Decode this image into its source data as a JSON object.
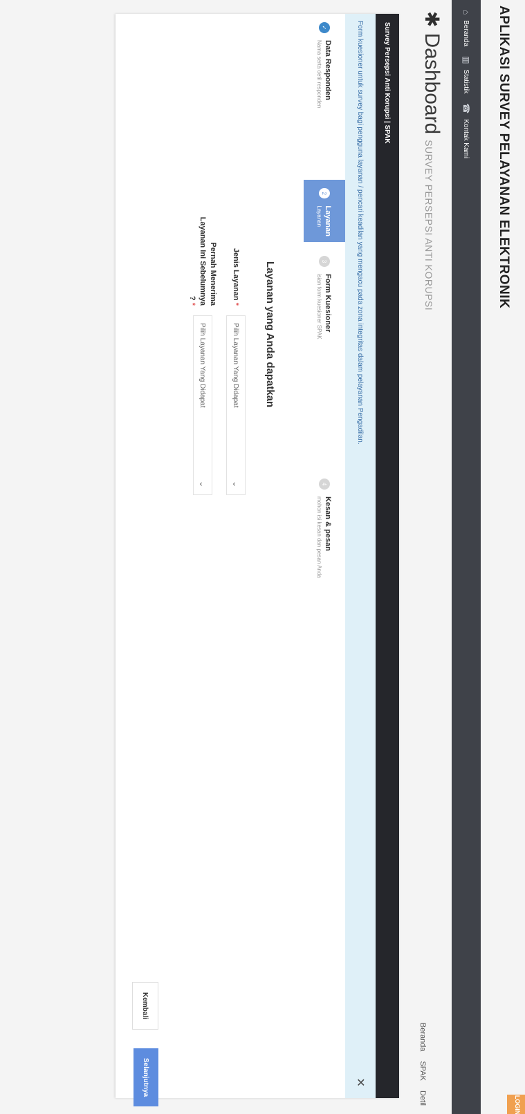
{
  "app_title": "APLIKASI SURVEY PELAYANAN ELEKTRONIK",
  "login_label": "LOGIN",
  "nav": [
    {
      "label": "Beranda",
      "icon": "home-icon"
    },
    {
      "label": "Statistik",
      "icon": "chart-icon"
    },
    {
      "label": "Kontak Kami",
      "icon": "phone-icon"
    }
  ],
  "dashboard": {
    "title": "Dashboard",
    "subtitle": "SURVEY PERSEPSI ANTI KORUPSI"
  },
  "top_links": [
    "Beranda",
    "SPAK",
    "Detil"
  ],
  "panel": {
    "header": "Survey Persepsi Anti Korupsi | SPAK",
    "info": "Form kuesioner untuk survey bagi pengguna layanan / pencari keadilan yang mengacu pada zona integritas dalam pelayanan Pengadilan."
  },
  "steps": [
    {
      "num": "✓",
      "title": "Data Responden",
      "subtitle": "Nama serta detil responden",
      "state": "done"
    },
    {
      "num": "2",
      "title": "Layanan",
      "subtitle": "Layanan",
      "state": "active"
    },
    {
      "num": "3",
      "title": "Form Kuesioner",
      "subtitle": "isian form kuesioner SPAK",
      "state": "pending"
    },
    {
      "num": "4",
      "title": "Kesan & pesan",
      "subtitle": "mohon isi kesan dan pesan Anda",
      "state": "pending"
    }
  ],
  "form": {
    "title": "Layanan yang Anda dapatkan",
    "fields": [
      {
        "label": "Jenis Layanan",
        "required": "*",
        "placeholder": "Pilih Layanan Yang Didapat"
      },
      {
        "label": "Pernah Menerima Layanan Ini Sebelumnya ?",
        "required": "*",
        "placeholder": "Pilih Layanan Yang Didapat"
      }
    ]
  },
  "buttons": {
    "back": "Kembali",
    "next": "Selanjutnya"
  }
}
